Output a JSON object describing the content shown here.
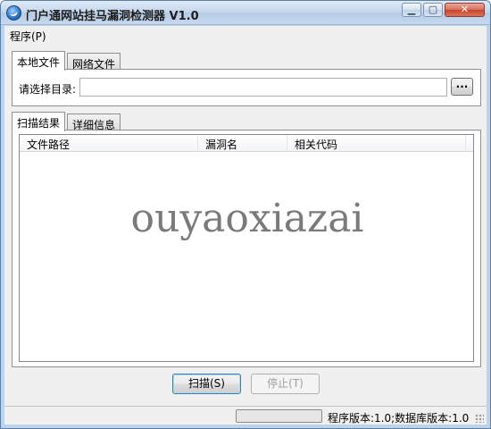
{
  "window": {
    "title": "门户通网站挂马漏洞检测器 V1.0",
    "minimize_glyph": "▁",
    "maximize_glyph": "▢",
    "close_glyph": "✕"
  },
  "menu": {
    "program": "程序(P)"
  },
  "source_tabs": [
    {
      "label": "本地文件",
      "active": true
    },
    {
      "label": "网络文件",
      "active": false
    }
  ],
  "local": {
    "dir_label": "请选择目录:",
    "dir_value": "",
    "browse_label": "..."
  },
  "result_tabs": [
    {
      "label": "扫描结果",
      "active": true
    },
    {
      "label": "详细信息",
      "active": false
    }
  ],
  "results": {
    "columns": [
      "文件路径",
      "漏洞名",
      "相关代码"
    ],
    "rows": [],
    "watermark": "ouyaoxiazai"
  },
  "buttons": {
    "scan": "扫描(S)",
    "stop": "停止(T)"
  },
  "status": {
    "progress": 0,
    "version_text": "程序版本:1.0;数据库版本:1.0"
  },
  "colors": {
    "titlebar": "#c3d6ec",
    "close_button": "#c7442b",
    "client_bg": "#f0f0f0"
  }
}
